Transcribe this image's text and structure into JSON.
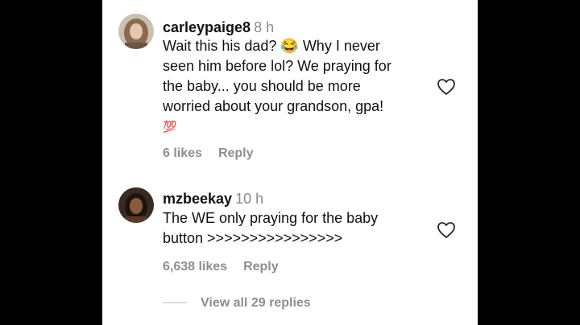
{
  "comments": [
    {
      "username": "carleypaige8",
      "time": "8 h",
      "lines": [
        "Wait this his dad? 😂 Why I never",
        "seen him before lol? We praying for",
        "the baby... you should be more",
        "worried about your grandson, gpa!",
        "💯"
      ],
      "likes": "6 likes",
      "reply": "Reply"
    },
    {
      "username": "mzbeekay",
      "time": "10 h",
      "lines": [
        "The WE only praying for the baby",
        "button >>>>>>>>>>>>>>>>"
      ],
      "likes": "6,638 likes",
      "reply": "Reply"
    }
  ],
  "view_replies": "View all 29 replies",
  "icons": {
    "like": "heart-outline-icon"
  },
  "colors": {
    "background": "#000000",
    "panel": "#ffffff",
    "muted": "#8e8e8e"
  }
}
